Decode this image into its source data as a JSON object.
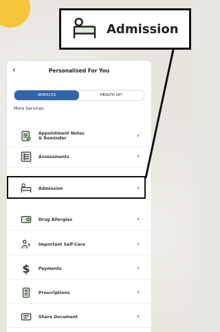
{
  "screen": {
    "header": {
      "title": "Personalised For You",
      "subtitle": "",
      "back_icon": "chevron-left-icon"
    },
    "tabs": [
      {
        "label": "SERVICES",
        "active": true
      },
      {
        "label": "HEALTH UP!",
        "active": false
      }
    ],
    "section_title": "More Services",
    "items": [
      {
        "label": "Appointment Notes\n& Reminder",
        "icon": "appointment-notes-icon"
      },
      {
        "label": "Assessments",
        "icon": "assessments-icon"
      },
      {
        "label": "Admission",
        "icon": "admission-icon"
      },
      {
        "label": "Drug Allergies",
        "icon": "drug-allergies-icon"
      },
      {
        "label": "Important Self-Care",
        "icon": "self-care-icon"
      },
      {
        "label": "Payments",
        "icon": "payments-icon"
      },
      {
        "label": "Prescriptions",
        "icon": "prescriptions-icon"
      },
      {
        "label": "Share Document",
        "icon": "share-document-icon"
      }
    ]
  },
  "callout": {
    "label": "Admission",
    "icon": "admission-icon"
  },
  "colors": {
    "accent": "#2f64a8",
    "highlight_border": "#111111",
    "yellow": "#f6c53a"
  }
}
